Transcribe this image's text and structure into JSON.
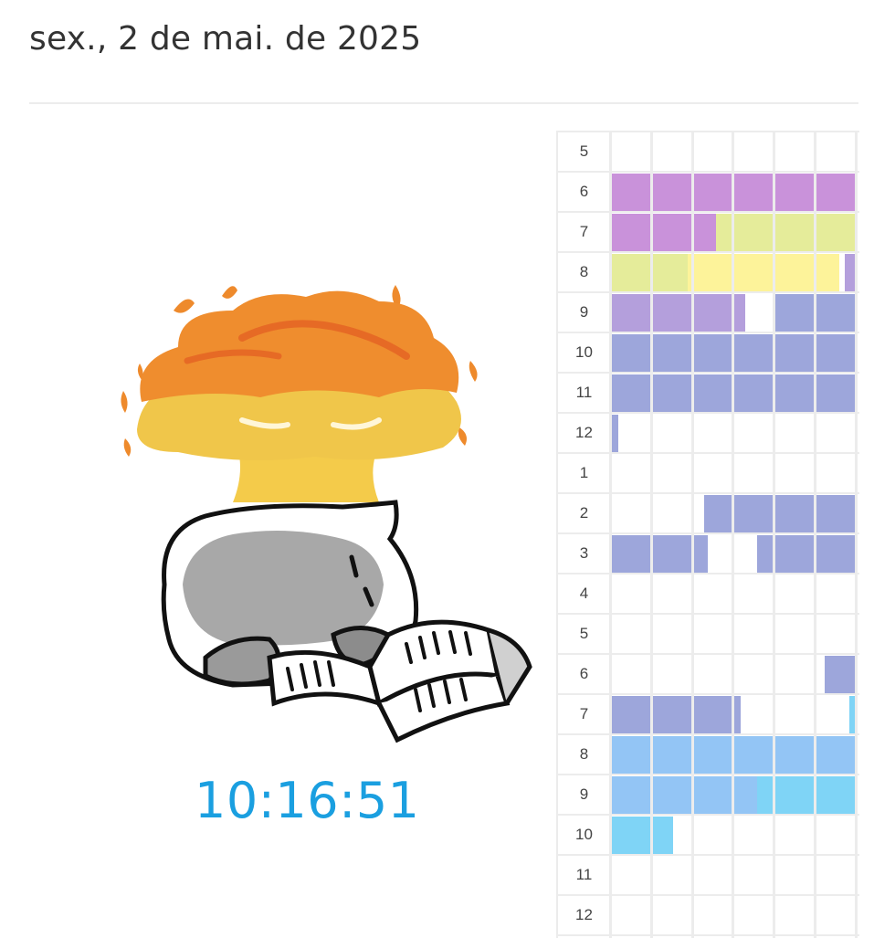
{
  "header": {
    "date": "sex., 2 de mai. de 2025"
  },
  "clock": {
    "time": "10:16:51",
    "color": "#1a9fe0"
  },
  "illustration": {
    "icon": "cat-reading-explosion-icon"
  },
  "timeline": {
    "cells_per_row": 6,
    "colors": {
      "purple": "#c992da",
      "lime": "#e5ec9a",
      "yellow": "#fdf39a",
      "lavender": "#b49fdc",
      "indigo": "#9da6db",
      "blue": "#93c5f5",
      "sky": "#7fd4f6"
    },
    "rows": [
      {
        "hour": "5",
        "segments": []
      },
      {
        "hour": "6",
        "segments": [
          {
            "start": 0,
            "end": 6,
            "color": "purple"
          }
        ]
      },
      {
        "hour": "7",
        "segments": [
          {
            "start": 0,
            "end": 2.6,
            "color": "purple"
          },
          {
            "start": 2.6,
            "end": 6,
            "color": "lime"
          }
        ]
      },
      {
        "hour": "8",
        "segments": [
          {
            "start": 0,
            "end": 1.9,
            "color": "lime"
          },
          {
            "start": 1.9,
            "end": 5.6,
            "color": "yellow"
          },
          {
            "start": 5.75,
            "end": 6,
            "color": "lavender"
          }
        ]
      },
      {
        "hour": "9",
        "segments": [
          {
            "start": 0,
            "end": 3.3,
            "color": "lavender"
          },
          {
            "start": 4,
            "end": 6,
            "color": "indigo"
          }
        ]
      },
      {
        "hour": "10",
        "segments": [
          {
            "start": 0,
            "end": 6,
            "color": "indigo"
          }
        ]
      },
      {
        "hour": "11",
        "segments": [
          {
            "start": 0,
            "end": 6,
            "color": "indigo"
          }
        ]
      },
      {
        "hour": "12",
        "segments": [
          {
            "start": 0,
            "end": 0.2,
            "color": "indigo"
          }
        ]
      },
      {
        "hour": "1",
        "segments": []
      },
      {
        "hour": "2",
        "segments": [
          {
            "start": 2.3,
            "end": 6,
            "color": "indigo"
          }
        ]
      },
      {
        "hour": "3",
        "segments": [
          {
            "start": 0,
            "end": 2.4,
            "color": "indigo"
          },
          {
            "start": 3.6,
            "end": 6,
            "color": "indigo"
          }
        ]
      },
      {
        "hour": "4",
        "segments": []
      },
      {
        "hour": "5",
        "segments": []
      },
      {
        "hour": "6",
        "segments": [
          {
            "start": 5.25,
            "end": 6,
            "color": "indigo"
          }
        ]
      },
      {
        "hour": "7",
        "segments": [
          {
            "start": 0,
            "end": 3.2,
            "color": "indigo"
          },
          {
            "start": 5.85,
            "end": 6,
            "color": "sky"
          }
        ]
      },
      {
        "hour": "8",
        "segments": [
          {
            "start": 0,
            "end": 6,
            "color": "blue"
          }
        ]
      },
      {
        "hour": "9",
        "segments": [
          {
            "start": 0,
            "end": 3.6,
            "color": "blue"
          },
          {
            "start": 3.6,
            "end": 6,
            "color": "sky"
          }
        ]
      },
      {
        "hour": "10",
        "segments": [
          {
            "start": 0,
            "end": 1.55,
            "color": "sky"
          }
        ]
      },
      {
        "hour": "11",
        "segments": []
      },
      {
        "hour": "12",
        "segments": []
      }
    ]
  }
}
